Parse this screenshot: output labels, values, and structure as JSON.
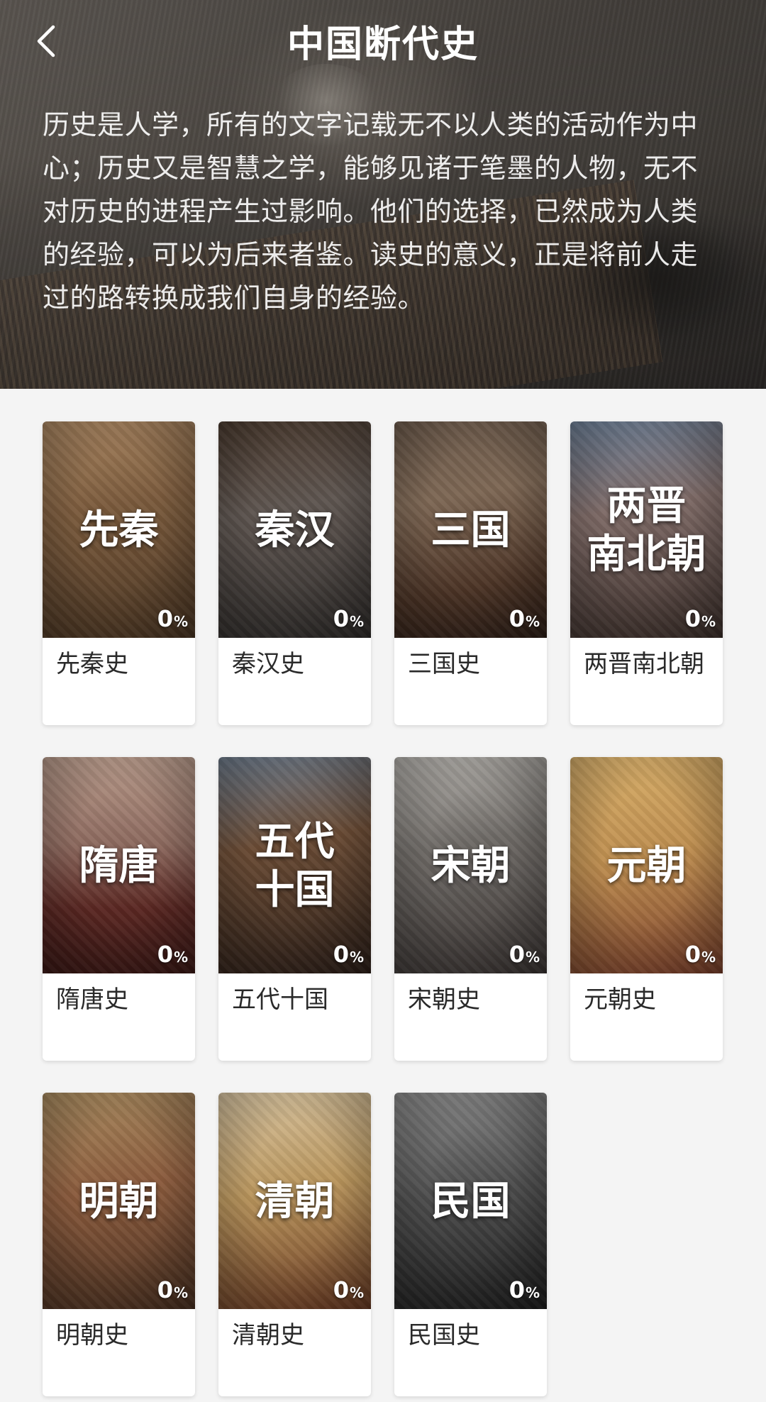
{
  "header": {
    "back_icon": "chevron-left-icon",
    "title": "中国断代史",
    "intro": "历史是人学，所有的文字记载无不以人类的活动作为中心；历史又是智慧之学，能够见诸于笔墨的人物，无不对历史的进程产生过影响。他们的选择，已然成为人类的经验，可以为后来者鉴。读史的意义，正是将前人走过的路转换成我们自身的经验。"
  },
  "periods": [
    {
      "cover_title": "先秦",
      "label": "先秦史",
      "progress": "0",
      "unit": "%"
    },
    {
      "cover_title": "秦汉",
      "label": "秦汉史",
      "progress": "0",
      "unit": "%"
    },
    {
      "cover_title": "三国",
      "label": "三国史",
      "progress": "0",
      "unit": "%"
    },
    {
      "cover_title": "两晋\n南北朝",
      "label": "两晋南北朝",
      "progress": "0",
      "unit": "%"
    },
    {
      "cover_title": "隋唐",
      "label": "隋唐史",
      "progress": "0",
      "unit": "%"
    },
    {
      "cover_title": "五代\n十国",
      "label": "五代十国",
      "progress": "0",
      "unit": "%"
    },
    {
      "cover_title": "宋朝",
      "label": "宋朝史",
      "progress": "0",
      "unit": "%"
    },
    {
      "cover_title": "元朝",
      "label": "元朝史",
      "progress": "0",
      "unit": "%"
    },
    {
      "cover_title": "明朝",
      "label": "明朝史",
      "progress": "0",
      "unit": "%"
    },
    {
      "cover_title": "清朝",
      "label": "清朝史",
      "progress": "0",
      "unit": "%"
    },
    {
      "cover_title": "民国",
      "label": "民国史",
      "progress": "0",
      "unit": "%"
    }
  ]
}
